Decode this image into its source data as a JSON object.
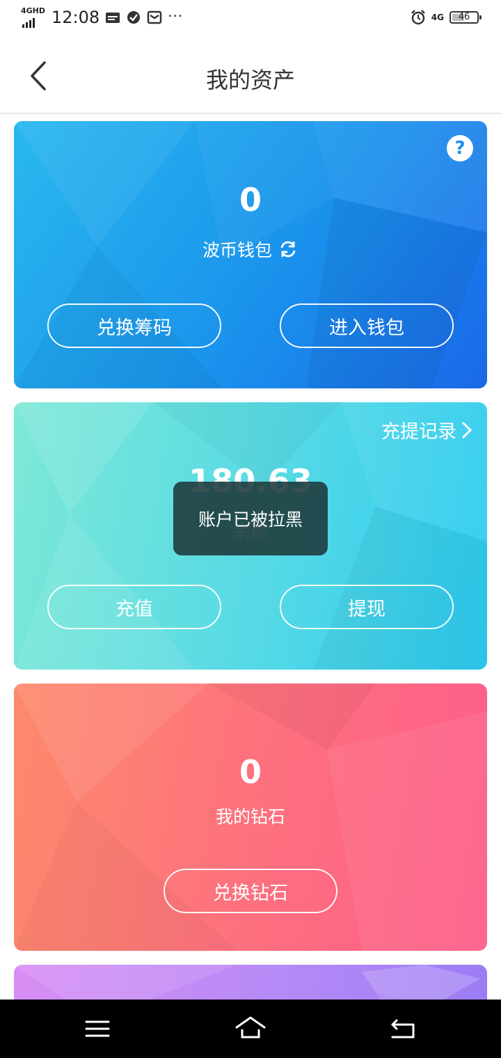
{
  "status_bar": {
    "network_label": "4GHD",
    "time": "12:08",
    "more": "···",
    "net_right": "4G",
    "battery": "46"
  },
  "header": {
    "title": "我的资产"
  },
  "cards": {
    "wallet": {
      "amount": "0",
      "label": "波币钱包",
      "btn_left": "兑换筹码",
      "btn_right": "进入钱包",
      "help": "?"
    },
    "balance": {
      "amount": "180.63",
      "label": "余额",
      "link": "充提记录",
      "btn_left": "充值",
      "btn_right": "提现"
    },
    "diamond": {
      "amount": "0",
      "label": "我的钻石",
      "btn": "兑换钻石"
    }
  },
  "toast": {
    "text": "账户已被拉黑"
  },
  "icons": {
    "back": "back-arrow-icon",
    "help": "question-icon",
    "refresh": "refresh-icon",
    "chevron": "chevron-right-icon",
    "menu": "menu-icon",
    "home": "home-icon",
    "return": "return-icon"
  },
  "colors": {
    "wallet_card": "#1a93ec",
    "balance_card": "#55d9e6",
    "diamond_card": "#fd6f7f",
    "purple_card": "#b58af6",
    "toast_bg": "#1c383a"
  }
}
